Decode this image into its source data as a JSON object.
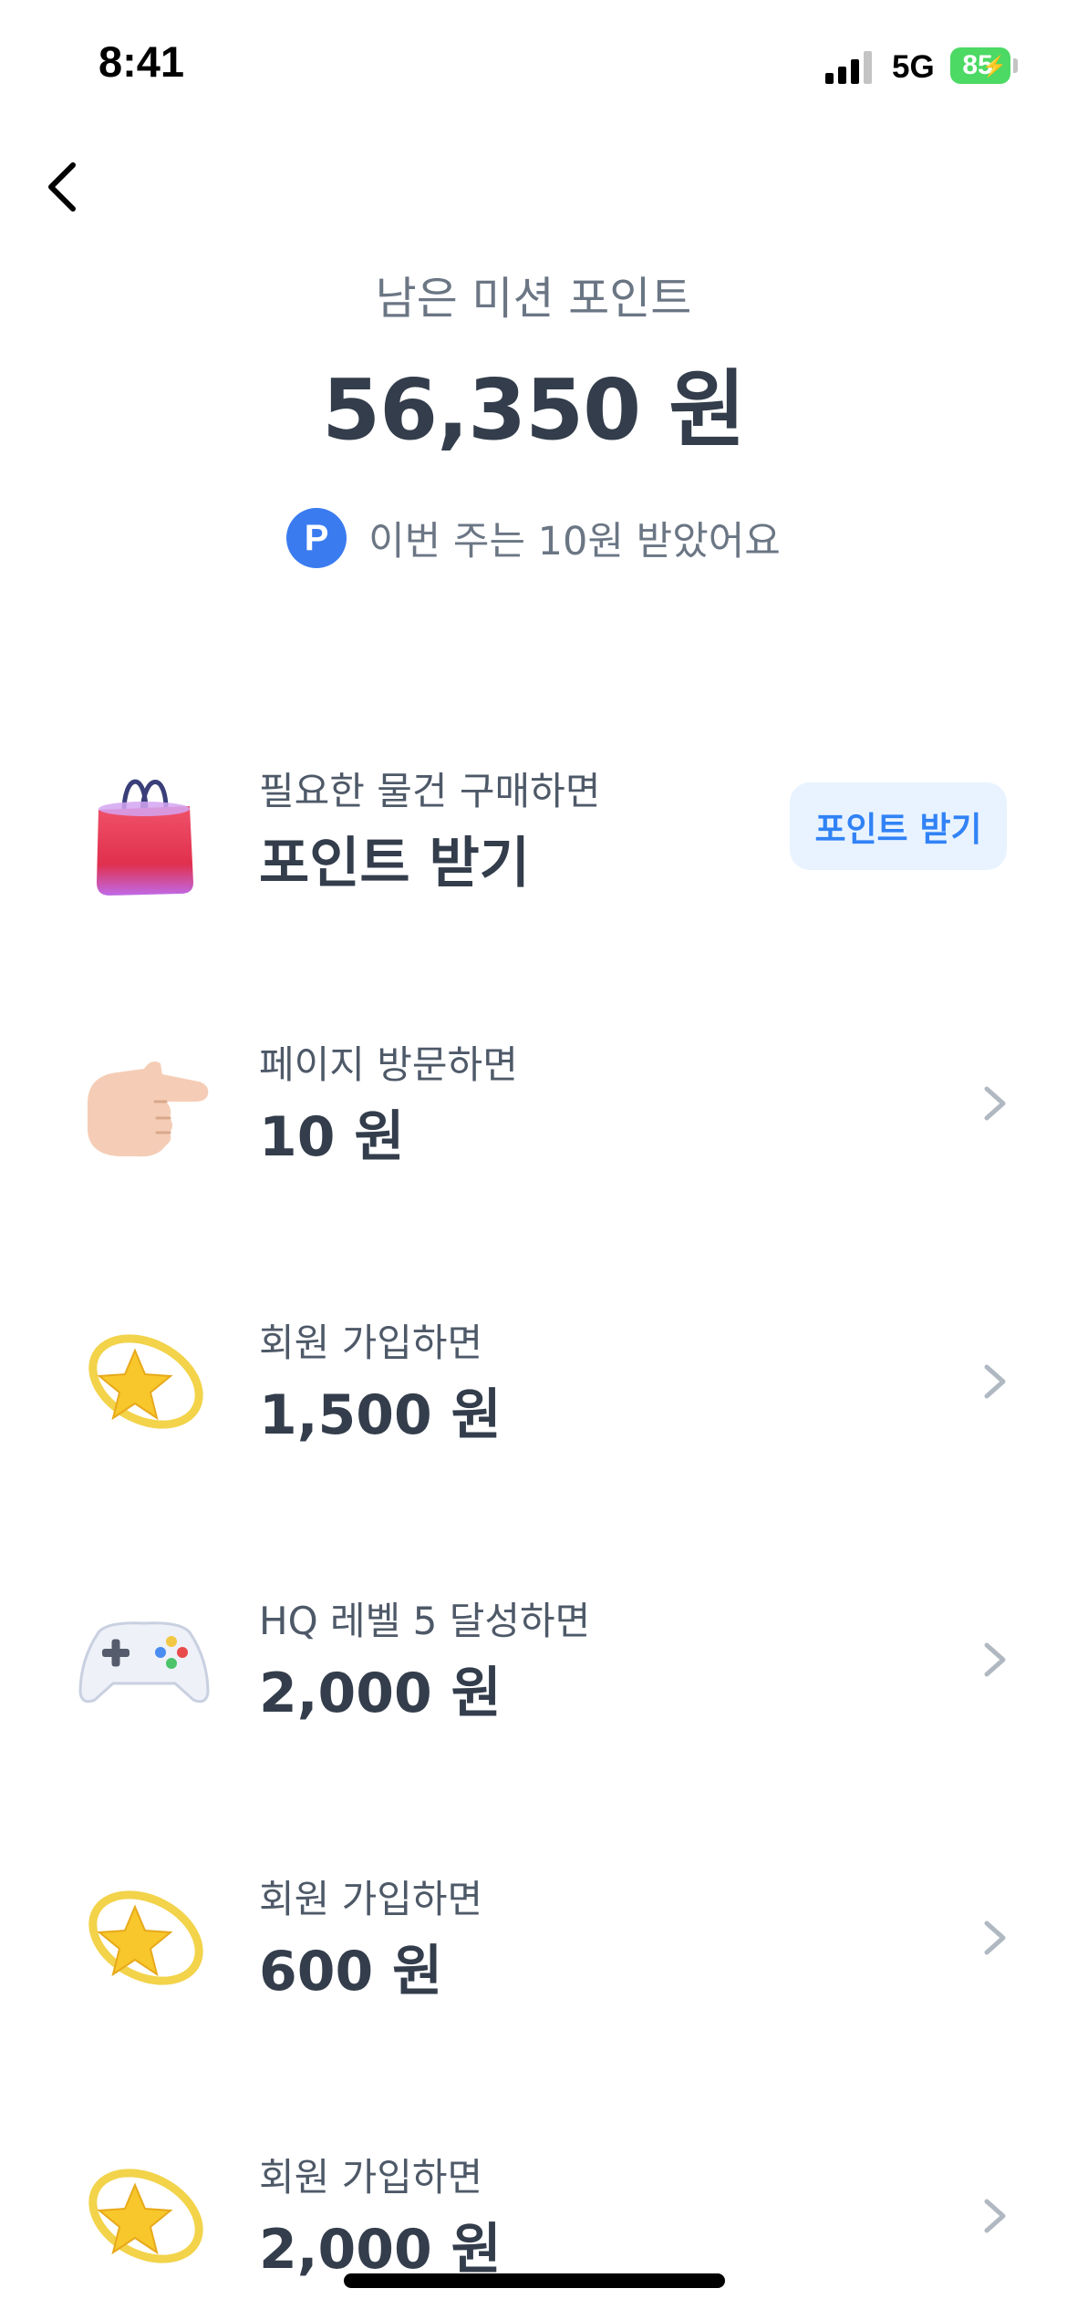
{
  "status_bar": {
    "time": "8:41",
    "network": "5G",
    "battery": "85"
  },
  "header": {
    "subtitle": "남은 미션 포인트",
    "amount": "56,350 원",
    "weekly_badge": "P",
    "weekly_text": "이번 주는 10원 받았어요"
  },
  "missions": [
    {
      "icon": "shopping-bag-icon",
      "subtitle": "필요한 물건 구매하면",
      "title": "포인트 받기",
      "button_label": "포인트 받기"
    },
    {
      "icon": "pointing-hand-icon",
      "subtitle": "페이지 방문하면",
      "title": "10 원"
    },
    {
      "icon": "star-ring-icon",
      "subtitle": "회원 가입하면",
      "title": "1,500 원"
    },
    {
      "icon": "game-controller-icon",
      "subtitle": "HQ 레벨 5 달성하면",
      "title": "2,000 원"
    },
    {
      "icon": "star-ring-icon",
      "subtitle": "회원 가입하면",
      "title": "600 원"
    },
    {
      "icon": "star-ring-icon",
      "subtitle": "회원 가입하면",
      "title": "2,000 원"
    }
  ],
  "colors": {
    "accent": "#3182f6",
    "badge": "#3a7bf0",
    "button_bg": "#e8f3ff",
    "text_primary": "#333d4b",
    "text_secondary": "#6b7684",
    "battery": "#4cd964"
  }
}
